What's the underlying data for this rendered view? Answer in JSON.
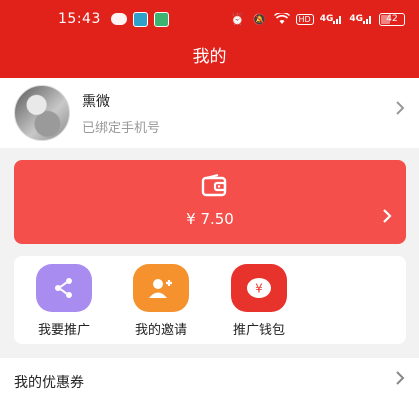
{
  "status_bar": {
    "time": "15:43",
    "network_label": "HD",
    "signal_1": "4G",
    "signal_2": "4G",
    "battery": "42",
    "battery_level": 0.42
  },
  "header": {
    "title": "我的",
    "background_color": "#e1221b"
  },
  "profile": {
    "name": "熏微",
    "subtitle": "已绑定手机号"
  },
  "wallet": {
    "amount": "¥ 7.50",
    "icon": "wallet-icon",
    "card_color": "#f44f4b"
  },
  "shortcuts": [
    {
      "label": "我要推广",
      "icon": "share-icon",
      "color": "#a98cf0"
    },
    {
      "label": "我的邀请",
      "icon": "invite-user-icon",
      "color": "#f5922e"
    },
    {
      "label": "推广钱包",
      "icon": "red-packet-icon",
      "color": "#e8332c"
    }
  ],
  "coupon": {
    "label": "我的优惠券"
  }
}
